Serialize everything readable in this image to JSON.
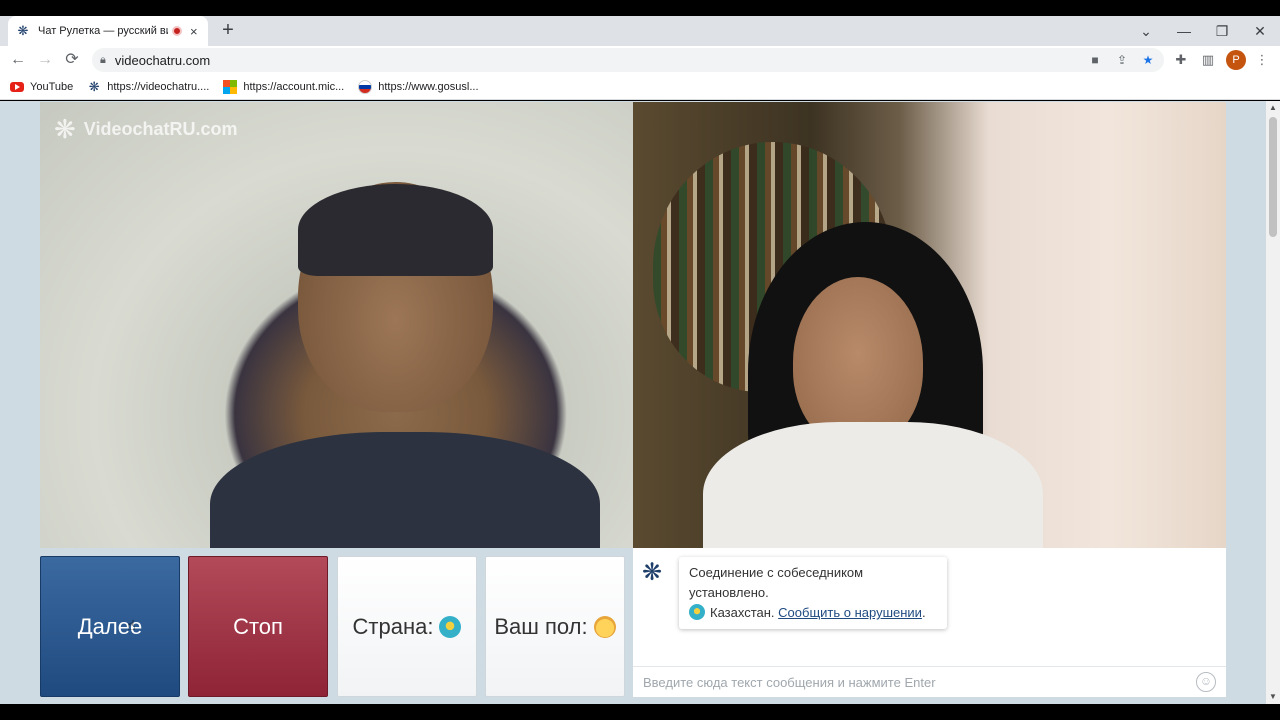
{
  "browser": {
    "tab": {
      "title": "Чат Рулетка — русский видео",
      "close": "×"
    },
    "new_tab": "+",
    "window_controls": {
      "menu": "⌄",
      "minimize": "—",
      "restore": "❐",
      "close": "✕"
    },
    "nav": {
      "back": "←",
      "forward": "→",
      "reload": "⟳"
    },
    "url": "videochatru.com",
    "avatar_letter": "P",
    "bookmarks": [
      {
        "label": "YouTube",
        "icon": "youtube-icon"
      },
      {
        "label": "https://videochatru....",
        "icon": "videochat-icon"
      },
      {
        "label": "https://account.mic...",
        "icon": "microsoft-icon"
      },
      {
        "label": "https://www.gosusl...",
        "icon": "russia-flag-icon"
      }
    ]
  },
  "video": {
    "logo_text": "VideochatRU.com"
  },
  "controls": {
    "next_label": "Далее",
    "stop_label": "Стоп",
    "country_label": "Страна:",
    "gender_label": "Ваш пол:"
  },
  "chat": {
    "message_line1": "Соединение с собеседником установлено.",
    "country": "Казахстан.",
    "report_link": "Сообщить о нарушении",
    "period": ".",
    "input_placeholder": "Введите сюда текст сообщения и нажмите Enter"
  },
  "colors": {
    "next_button": "#2b5a91",
    "stop_button": "#a03548",
    "page_background": "#cfdbe3",
    "accent": "#1f4a80"
  }
}
